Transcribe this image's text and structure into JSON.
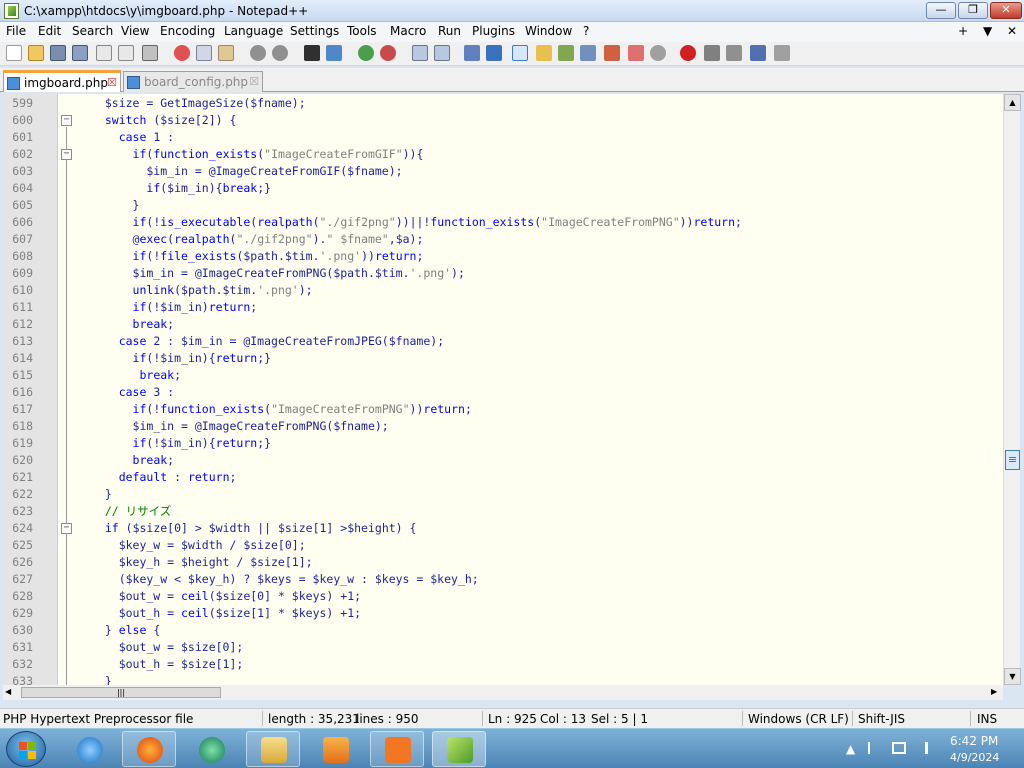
{
  "window": {
    "title": "C:\\xampp\\htdocs\\y\\imgboard.php - Notepad++",
    "minimize": "—",
    "maximize": "❐",
    "close": "✕"
  },
  "menu": [
    "File",
    "Edit",
    "Search",
    "View",
    "Encoding",
    "Language",
    "Settings",
    "Tools",
    "Macro",
    "Run",
    "Plugins",
    "Window",
    "?"
  ],
  "menu_right": [
    "+",
    "▼",
    "✕"
  ],
  "tabs": [
    {
      "label": "imgboard.php",
      "close": "☒",
      "active": true
    },
    {
      "label": "board_config.php",
      "close": "☒",
      "active": false
    }
  ],
  "editor": {
    "lines": [
      {
        "n": "599",
        "fold": "",
        "text": "  $size = GetImageSize($fname);"
      },
      {
        "n": "600",
        "fold": "−",
        "text": "  switch ($size[2]) {"
      },
      {
        "n": "601",
        "fold": "",
        "text": "    case 1 :"
      },
      {
        "n": "602",
        "fold": "−",
        "text": "      if(function_exists(\"ImageCreateFromGIF\")){"
      },
      {
        "n": "603",
        "fold": "",
        "text": "        $im_in = @ImageCreateFromGIF($fname);"
      },
      {
        "n": "604",
        "fold": "",
        "text": "        if($im_in){break;}"
      },
      {
        "n": "605",
        "fold": "",
        "text": "      }"
      },
      {
        "n": "606",
        "fold": "",
        "text": "      if(!is_executable(realpath(\"./gif2png\"))||!function_exists(\"ImageCreateFromPNG\"))return;"
      },
      {
        "n": "607",
        "fold": "",
        "text": "      @exec(realpath(\"./gif2png\").\" $fname\",$a);"
      },
      {
        "n": "608",
        "fold": "",
        "text": "      if(!file_exists($path.$tim.'.png'))return;"
      },
      {
        "n": "609",
        "fold": "",
        "text": "      $im_in = @ImageCreateFromPNG($path.$tim.'.png');"
      },
      {
        "n": "610",
        "fold": "",
        "text": "      unlink($path.$tim.'.png');"
      },
      {
        "n": "611",
        "fold": "",
        "text": "      if(!$im_in)return;"
      },
      {
        "n": "612",
        "fold": "",
        "text": "      break;"
      },
      {
        "n": "613",
        "fold": "",
        "text": "    case 2 : $im_in = @ImageCreateFromJPEG($fname);"
      },
      {
        "n": "614",
        "fold": "",
        "text": "      if(!$im_in){return;}"
      },
      {
        "n": "615",
        "fold": "",
        "text": "       break;"
      },
      {
        "n": "616",
        "fold": "",
        "text": "    case 3 :"
      },
      {
        "n": "617",
        "fold": "",
        "text": "      if(!function_exists(\"ImageCreateFromPNG\"))return;"
      },
      {
        "n": "618",
        "fold": "",
        "text": "      $im_in = @ImageCreateFromPNG($fname);"
      },
      {
        "n": "619",
        "fold": "",
        "text": "      if(!$im_in){return;}"
      },
      {
        "n": "620",
        "fold": "",
        "text": "      break;"
      },
      {
        "n": "621",
        "fold": "",
        "text": "    default : return;"
      },
      {
        "n": "622",
        "fold": "",
        "text": "  }"
      },
      {
        "n": "623",
        "fold": "",
        "text": "  // リサイズ"
      },
      {
        "n": "624",
        "fold": "−",
        "text": "  if ($size[0] > $width || $size[1] >$height) {"
      },
      {
        "n": "625",
        "fold": "",
        "text": "    $key_w = $width / $size[0];"
      },
      {
        "n": "626",
        "fold": "",
        "text": "    $key_h = $height / $size[1];"
      },
      {
        "n": "627",
        "fold": "",
        "text": "    ($key_w < $key_h) ? $keys = $key_w : $keys = $key_h;"
      },
      {
        "n": "628",
        "fold": "",
        "text": "    $out_w = ceil($size[0] * $keys) +1;"
      },
      {
        "n": "629",
        "fold": "",
        "text": "    $out_h = ceil($size[1] * $keys) +1;"
      },
      {
        "n": "630",
        "fold": "",
        "text": "  } else {"
      },
      {
        "n": "631",
        "fold": "",
        "text": "    $out_w = $size[0];"
      },
      {
        "n": "632",
        "fold": "",
        "text": "    $out_h = $size[1];"
      },
      {
        "n": "633",
        "fold": "",
        "text": "  }"
      }
    ]
  },
  "scroll": {
    "up": "▲",
    "down": "▼",
    "left": "◀",
    "right": "▶",
    "grip": "|||",
    "thumb": "≡"
  },
  "status": {
    "file_type": "PHP Hypertext Preprocessor file",
    "length": "length : 35,231",
    "lines": "lines : 950",
    "ln": "Ln : 925",
    "col": "Col : 13",
    "sel": "Sel : 5 | 1",
    "eol": "Windows (CR LF)",
    "encoding": "Shift-JIS",
    "mode": "INS"
  },
  "taskbar": {
    "apps": [
      "internet-explorer-icon",
      "firefox-icon",
      "chat-icon",
      "file-explorer-icon",
      "media-player-icon",
      "xampp-icon",
      "notepadpp-icon"
    ],
    "time": "6:42 PM",
    "date": "4/9/2024",
    "tray_expand": "▲"
  }
}
